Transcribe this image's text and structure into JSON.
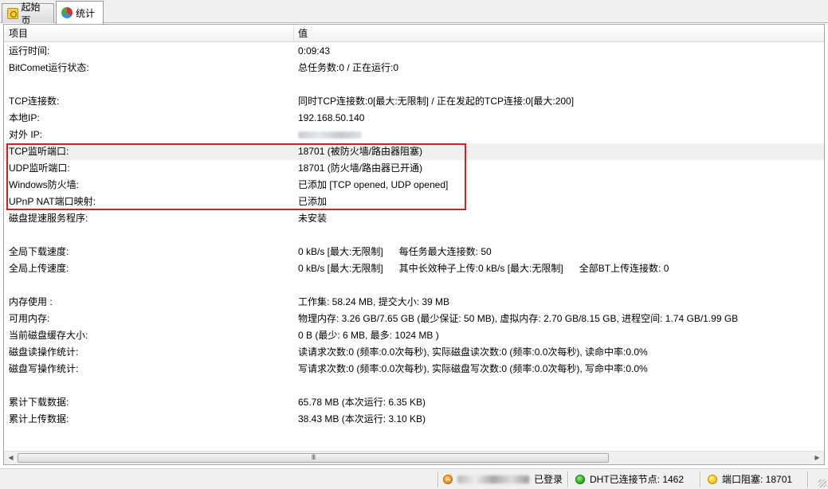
{
  "tabs": [
    {
      "label": "起始页",
      "icon": "home-page-icon"
    },
    {
      "label": "统计",
      "icon": "statistics-icon"
    }
  ],
  "table": {
    "headers": [
      "项目",
      "值"
    ],
    "rows": [
      {
        "key": "运行时间:",
        "value": "0:09:43"
      },
      {
        "key": "BitComet运行状态:",
        "value": "总任务数:0 / 正在运行:0"
      },
      {
        "key": "",
        "value": ""
      },
      {
        "key": "TCP连接数:",
        "value": "同时TCP连接数:0[最大:无限制] / 正在发起的TCP连接:0[最大:200]"
      },
      {
        "key": "本地IP:",
        "value": "192.168.50.140"
      },
      {
        "key": "对外 IP:",
        "value": ""
      },
      {
        "key": "TCP监听端口:",
        "value": "18701 (被防火墙/路由器阻塞)"
      },
      {
        "key": "UDP监听端口:",
        "value": "18701 (防火墙/路由器已开通)"
      },
      {
        "key": "Windows防火墙:",
        "value": "已添加 [TCP opened, UDP opened]"
      },
      {
        "key": "UPnP NAT端口映射:",
        "value": "已添加"
      },
      {
        "key": "磁盘提速服务程序:",
        "value": "未安装"
      },
      {
        "key": "",
        "value": ""
      },
      {
        "key": "全局下载速度:",
        "value": "0 kB/s [最大:无限制]      每任务最大连接数: 50"
      },
      {
        "key": "全局上传速度:",
        "value": "0 kB/s [最大:无限制]      其中长效种子上传:0 kB/s [最大:无限制]      全部BT上传连接数: 0"
      },
      {
        "key": "",
        "value": ""
      },
      {
        "key": "内存使用 :",
        "value": "工作集: 58.24 MB, 提交大小: 39 MB"
      },
      {
        "key": "可用内存:",
        "value": "物理内存: 3.26 GB/7.65 GB (最少保证: 50 MB), 虚拟内存: 2.70 GB/8.15 GB, 进程空间: 1.74 GB/1.99 GB"
      },
      {
        "key": "当前磁盘缓存大小:",
        "value": "0 B (最少: 6 MB, 最多: 1024 MB )"
      },
      {
        "key": "磁盘读操作统计:",
        "value": "读请求次数:0 (频率:0.0次每秒), 实际磁盘读次数:0 (频率:0.0次每秒), 读命中率:0.0%"
      },
      {
        "key": "磁盘写操作统计:",
        "value": "写请求次数:0 (频率:0.0次每秒), 实际磁盘写次数:0 (频率:0.0次每秒), 写命中率:0.0%"
      },
      {
        "key": "",
        "value": ""
      },
      {
        "key": "累计下载数据:",
        "value": "65.78 MB (本次运行: 6.35 KB)"
      },
      {
        "key": "累计上传数据:",
        "value": "38.43 MB (本次运行: 3.10 KB)"
      }
    ]
  },
  "scrollbar": {
    "grip": "III"
  },
  "statusbar": {
    "login": "已登录",
    "dht": "DHT已连接节点: 1462",
    "port": "端口阻塞: 18701"
  },
  "colors": {
    "highlight_box": "#d71e1e",
    "selected_row": "#f0f0f0"
  }
}
